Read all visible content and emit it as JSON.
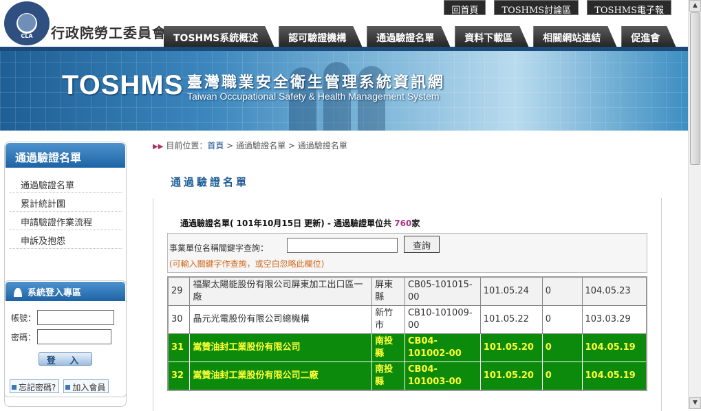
{
  "header": {
    "agency_name": "行政院勞工委員會",
    "seal_text": "CLA",
    "quick_links": [
      "回首頁",
      "TOSHMS討論區",
      "TOSHMS電子報"
    ],
    "nav_tabs": [
      "TOSHMS系統概述",
      "認可驗證機構",
      "通過驗證名單",
      "資料下載區",
      "相關網站連結",
      "促進會"
    ]
  },
  "banner": {
    "brand": "TOSHMS",
    "title_zh": "臺灣職業安全衛生管理系統資訊網",
    "title_en": "Taiwan Occupational Safety & Health Management System"
  },
  "sidebar": {
    "heading": "通過驗證名單",
    "items": [
      "通過驗證名單",
      "累計統計圖",
      "申請驗證作業流程",
      "申訴及抱怨"
    ]
  },
  "login": {
    "heading": "系統登入專區",
    "account_label": "帳號：",
    "password_label": "密碼：",
    "submit_label": "登 入",
    "forgot_label": "忘記密碼?",
    "join_label": "加入會員"
  },
  "breadcrumb": {
    "prefix": "目前位置：",
    "home": "首頁",
    "trail": " > 通過驗證名單 > 通過驗證名單"
  },
  "page_title": "通過驗證名單",
  "list_caption": {
    "text": "通過驗證名單( 101年10月15日 更新) - 通過驗證單位共 ",
    "count": "760",
    "suffix": "家"
  },
  "search": {
    "label": "事業單位名稱關鍵字查詢：",
    "value": "",
    "button": "查詢",
    "hint": "(可輸入關鍵字作查詢，或空白忽略此欄位)"
  },
  "results": [
    {
      "no": "29",
      "name": "福聚太陽能股份有限公司屏東加工出口區一廠",
      "county": "屏東縣",
      "cert": "CB05-101015-00",
      "issued": "101.05.24",
      "count": "0",
      "expires": "104.05.23",
      "style": "alt"
    },
    {
      "no": "30",
      "name": "晶元光電股份有限公司總機構",
      "county": "新竹市",
      "cert": "CB10-101009-00",
      "issued": "101.05.22",
      "count": "0",
      "expires": "103.03.29",
      "style": "normal"
    },
    {
      "no": "31",
      "name": "嵩贊油封工業股份有限公司",
      "county": "南投縣",
      "cert": "CB04-101002-00",
      "issued": "101.05.20",
      "count": "0",
      "expires": "104.05.19",
      "style": "hl"
    },
    {
      "no": "32",
      "name": "嵩贊油封工業股份有限公司二廠",
      "county": "南投縣",
      "cert": "CB04-101003-00",
      "issued": "101.05.20",
      "count": "0",
      "expires": "104.05.19",
      "style": "hl"
    }
  ],
  "colors": {
    "highlight_row_bg": "#0c8a0c",
    "highlight_row_text": "#ffff33",
    "accent_blue": "#1e63a4"
  }
}
